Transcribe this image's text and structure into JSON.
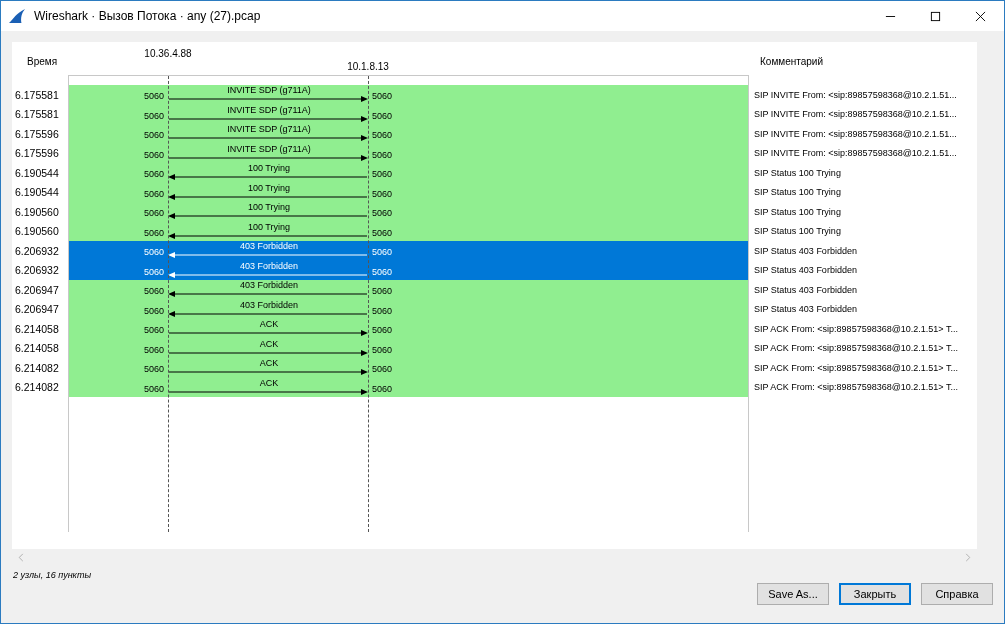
{
  "window": {
    "title": "Wireshark · Вызов Потока · any (27).pcap"
  },
  "columns": {
    "time": "Время",
    "comment": "Комментарий"
  },
  "nodes": [
    "10.36.4.88",
    "10.1.8.13"
  ],
  "rows": [
    {
      "time": "6.175581",
      "src_port": "5060",
      "dst_port": "5060",
      "label": "INVITE SDP (g711A)",
      "kind": "rightward",
      "selected": false,
      "comment": "SIP INVITE From: <sip:89857598368@10.2.1.51..."
    },
    {
      "time": "6.175581",
      "src_port": "5060",
      "dst_port": "5060",
      "label": "INVITE SDP (g711A)",
      "kind": "rightward",
      "selected": false,
      "comment": "SIP INVITE From: <sip:89857598368@10.2.1.51..."
    },
    {
      "time": "6.175596",
      "src_port": "5060",
      "dst_port": "5060",
      "label": "INVITE SDP (g711A)",
      "kind": "rightward",
      "selected": false,
      "comment": "SIP INVITE From: <sip:89857598368@10.2.1.51..."
    },
    {
      "time": "6.175596",
      "src_port": "5060",
      "dst_port": "5060",
      "label": "INVITE SDP (g711A)",
      "kind": "rightward",
      "selected": false,
      "comment": "SIP INVITE From: <sip:89857598368@10.2.1.51..."
    },
    {
      "time": "6.190544",
      "src_port": "5060",
      "dst_port": "5060",
      "label": "100 Trying",
      "kind": "leftward",
      "selected": false,
      "comment": "SIP Status 100 Trying"
    },
    {
      "time": "6.190544",
      "src_port": "5060",
      "dst_port": "5060",
      "label": "100 Trying",
      "kind": "leftward",
      "selected": false,
      "comment": "SIP Status 100 Trying"
    },
    {
      "time": "6.190560",
      "src_port": "5060",
      "dst_port": "5060",
      "label": "100 Trying",
      "kind": "leftward",
      "selected": false,
      "comment": "SIP Status 100 Trying"
    },
    {
      "time": "6.190560",
      "src_port": "5060",
      "dst_port": "5060",
      "label": "100 Trying",
      "kind": "leftward",
      "selected": false,
      "comment": "SIP Status 100 Trying"
    },
    {
      "time": "6.206932",
      "src_port": "5060",
      "dst_port": "5060",
      "label": "403 Forbidden",
      "kind": "leftward",
      "selected": true,
      "comment": "SIP Status 403 Forbidden"
    },
    {
      "time": "6.206932",
      "src_port": "5060",
      "dst_port": "5060",
      "label": "403 Forbidden",
      "kind": "leftward",
      "selected": true,
      "comment": "SIP Status 403 Forbidden"
    },
    {
      "time": "6.206947",
      "src_port": "5060",
      "dst_port": "5060",
      "label": "403 Forbidden",
      "kind": "leftward",
      "selected": false,
      "comment": "SIP Status 403 Forbidden"
    },
    {
      "time": "6.206947",
      "src_port": "5060",
      "dst_port": "5060",
      "label": "403 Forbidden",
      "kind": "leftward",
      "selected": false,
      "comment": "SIP Status 403 Forbidden"
    },
    {
      "time": "6.214058",
      "src_port": "5060",
      "dst_port": "5060",
      "label": "ACK",
      "kind": "rightward",
      "selected": false,
      "comment": "SIP ACK From: <sip:89857598368@10.2.1.51> T..."
    },
    {
      "time": "6.214058",
      "src_port": "5060",
      "dst_port": "5060",
      "label": "ACK",
      "kind": "rightward",
      "selected": false,
      "comment": "SIP ACK From: <sip:89857598368@10.2.1.51> T..."
    },
    {
      "time": "6.214082",
      "src_port": "5060",
      "dst_port": "5060",
      "label": "ACK",
      "kind": "rightward",
      "selected": false,
      "comment": "SIP ACK From: <sip:89857598368@10.2.1.51> T..."
    },
    {
      "time": "6.214082",
      "src_port": "5060",
      "dst_port": "5060",
      "label": "ACK",
      "kind": "rightward",
      "selected": false,
      "comment": "SIP ACK From: <sip:89857598368@10.2.1.51> T..."
    }
  ],
  "status": "2 узлы, 16 пункты",
  "buttons": [
    {
      "label": "Save As...",
      "default": false
    },
    {
      "label": "Закрыть",
      "default": true
    },
    {
      "label": "Справка",
      "default": false
    }
  ]
}
